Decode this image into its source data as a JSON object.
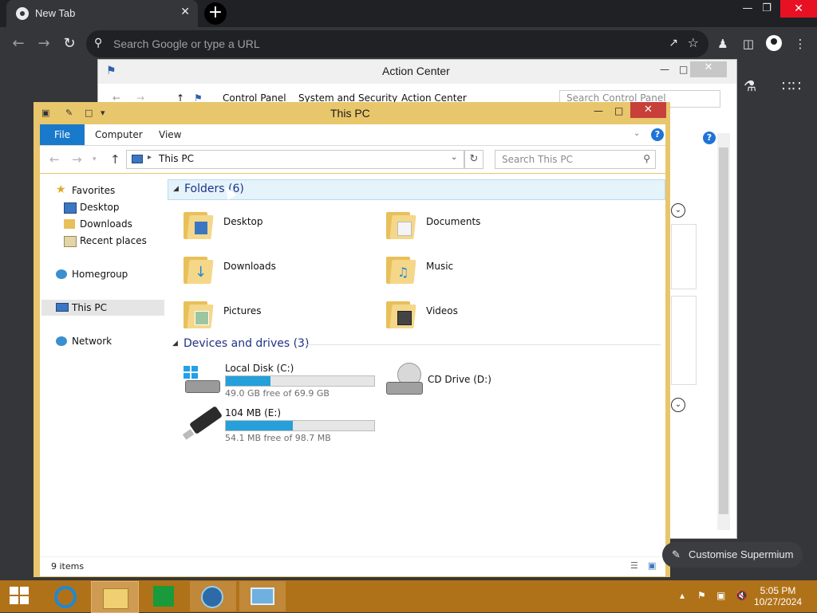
{
  "browser": {
    "tab_title": "New Tab",
    "tab_close": "✕",
    "new_tab": "+",
    "window_minimize": "—",
    "window_restore": "❐",
    "window_close": "✕",
    "omnibox_placeholder": "Search Google or type a URL",
    "customise_label": "Customise Supermium"
  },
  "action_center": {
    "title": "Action Center",
    "breadcrumbs": [
      "Control Panel",
      "System and Security",
      "Action Center"
    ],
    "search_placeholder": "Search Control Panel",
    "help": "?"
  },
  "explorer": {
    "title": "This PC",
    "ribbon_tabs": [
      "File",
      "Computer",
      "View"
    ],
    "help": "?",
    "address": "This PC",
    "search_placeholder": "Search This PC",
    "nav": {
      "favorites": "Favorites",
      "desktop": "Desktop",
      "downloads": "Downloads",
      "recent": "Recent places",
      "homegroup": "Homegroup",
      "thispc": "This PC",
      "network": "Network"
    },
    "folders_header": "Folders (6)",
    "folders": [
      "Desktop",
      "Documents",
      "Downloads",
      "Music",
      "Pictures",
      "Videos"
    ],
    "drives_header": "Devices and drives (3)",
    "drives": [
      {
        "name": "Local Disk (C:)",
        "free": "49.0 GB free of 69.9 GB",
        "used_fraction": 0.3
      },
      {
        "name": "CD Drive (D:)"
      },
      {
        "name": "104 MB (E:)",
        "free": "54.1 MB free of 98.7 MB",
        "used_fraction": 0.45
      }
    ],
    "status_count": "9 items"
  },
  "taskbar": {
    "time": "5:05 PM",
    "date": "10/27/2024"
  },
  "colors": {
    "explorer_frame": "#e8c66c",
    "taskbar": "#b07218",
    "drive_fill": "#26a0da",
    "chrome_bg": "#35363a"
  }
}
